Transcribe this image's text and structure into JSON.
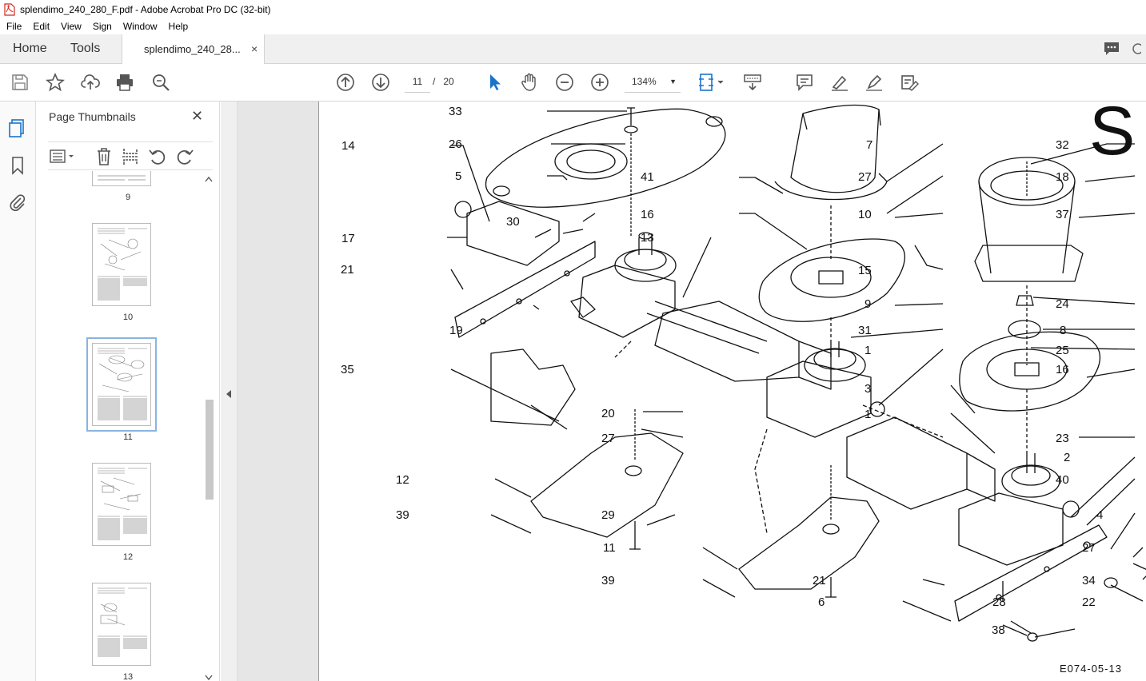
{
  "window": {
    "title": "splendimo_240_280_F.pdf - Adobe Acrobat Pro DC (32-bit)"
  },
  "menu": [
    "File",
    "Edit",
    "View",
    "Sign",
    "Window",
    "Help"
  ],
  "tabs": {
    "home": "Home",
    "tools": "Tools",
    "document": "splendimo_240_28...",
    "close": "×"
  },
  "toolbar": {
    "current_page": "11",
    "page_separator": "/",
    "total_pages": "20",
    "zoom": "134%"
  },
  "thumbnails_panel": {
    "title": "Page Thumbnails",
    "close": "✕",
    "pages": [
      {
        "label": "9",
        "active": false
      },
      {
        "label": "10",
        "active": false
      },
      {
        "label": "11",
        "active": true
      },
      {
        "label": "12",
        "active": false
      },
      {
        "label": "13",
        "active": false
      }
    ]
  },
  "document": {
    "page_letter": "S",
    "diagram_code": "E074-05-13",
    "callouts": [
      "33",
      "26",
      "5",
      "14",
      "30",
      "17",
      "21",
      "19",
      "35",
      "13",
      "41",
      "16",
      "7",
      "27",
      "10",
      "15",
      "9",
      "31",
      "1",
      "32",
      "18",
      "37",
      "24",
      "8",
      "25",
      "16",
      "23",
      "3",
      "1",
      "2",
      "40",
      "20",
      "27",
      "12",
      "39",
      "29",
      "11",
      "39",
      "4",
      "27",
      "34",
      "22",
      "21",
      "6",
      "28",
      "38"
    ]
  }
}
